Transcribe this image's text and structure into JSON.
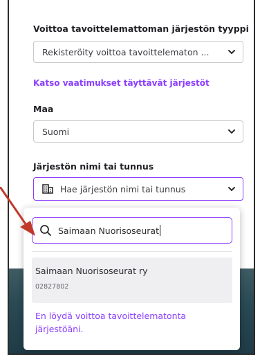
{
  "form": {
    "type_label": "Voittoa tavoittelemattoman järjestön tyyppi",
    "type_value": "Rekisteröity voittoa tavoittelematon ...",
    "requirements_link": "Katso vaatimukset täyttävät järjestöt",
    "country_label": "Maa",
    "country_value": "Suomi",
    "org_label": "Järjestön nimi tai tunnus",
    "org_placeholder": "Hae järjestön nimi tai tunnus"
  },
  "dropdown": {
    "search_value": "Saimaan Nuorisoseurat",
    "results": [
      {
        "name": "Saimaan Nuorisoseurat ry",
        "code": "02827802"
      }
    ],
    "not_found_link": "En löydä voittoa tavoittelematonta järjestöäni."
  },
  "colors": {
    "accent": "#8b3dff",
    "annotation_arrow": "#c0392b"
  }
}
